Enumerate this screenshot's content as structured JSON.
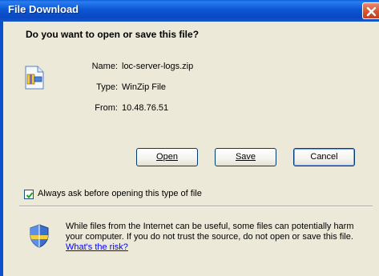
{
  "window": {
    "title": "File Download",
    "title_bar_color": "#0b56d3",
    "close_button_color": "#d9532f"
  },
  "dialog": {
    "question": "Do you want to open or save this file?",
    "file_icon": "winzip-file-icon",
    "details": {
      "name_label": "Name:",
      "name_value": "loc-server-logs.zip",
      "type_label": "Type:",
      "type_value": "WinZip File",
      "from_label": "From:",
      "from_value": "10.48.76.51"
    },
    "buttons": {
      "open": "Open",
      "save": "Save",
      "cancel": "Cancel"
    },
    "always_ask": {
      "checked": true,
      "label": "Always ask before opening this type of file"
    },
    "warning": {
      "icon": "security-shield-icon",
      "text": "While files from the Internet can be useful, some files can potentially harm your computer. If you do not trust the source, do not open or save this file.",
      "link": "What's the risk?"
    },
    "body_color": "#ece9d8"
  }
}
